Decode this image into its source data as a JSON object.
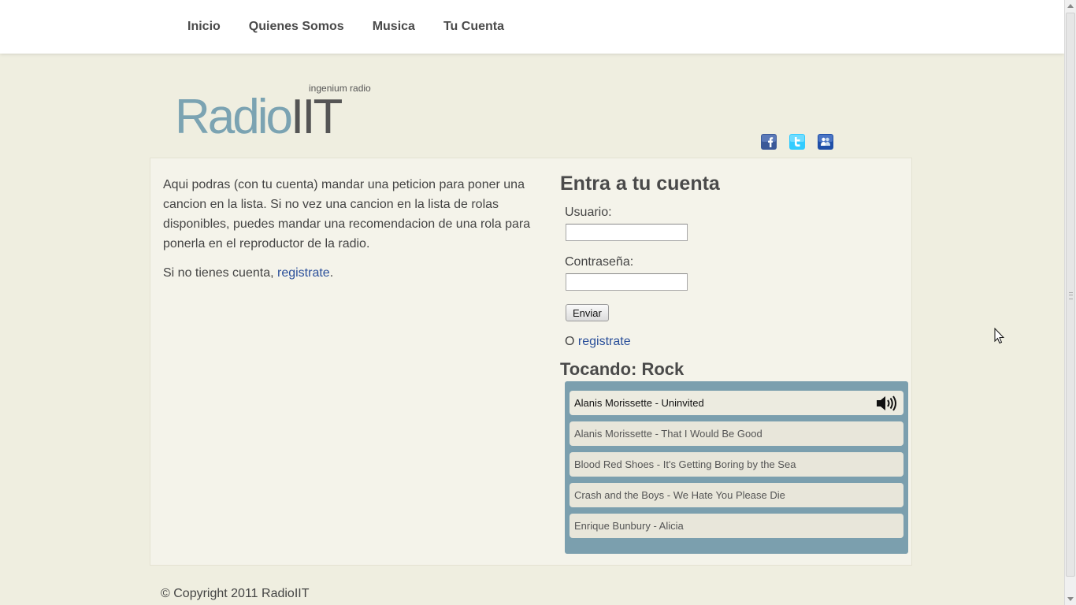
{
  "nav": {
    "items": [
      {
        "label": "Inicio"
      },
      {
        "label": "Quienes Somos"
      },
      {
        "label": "Musica"
      },
      {
        "label": "Tu Cuenta"
      }
    ]
  },
  "header": {
    "tagline": "ingenium radio",
    "logo_part1": "Radio",
    "logo_part2": "IIT"
  },
  "social": {
    "icons": [
      "facebook-icon",
      "twitter-icon",
      "messenger-icon"
    ],
    "colors": {
      "facebook": "#3b5998",
      "twitter": "#33ccff",
      "messenger": "#1f4fa8"
    }
  },
  "intro": {
    "paragraph": "Aqui podras (con tu cuenta) mandar una peticion para poner una cancion en la lista. Si no vez una cancion en la lista de rolas disponibles, puedes mandar una recomendacion de una rola para ponerla en el reproductor de la radio.",
    "no_account_prefix": "Si no tienes cuenta, ",
    "register_link": "registrate",
    "no_account_suffix": "."
  },
  "login": {
    "title": "Entra a tu cuenta",
    "user_label": "Usuario:",
    "user_value": "",
    "pass_label": "Contraseña:",
    "pass_value": "",
    "submit_label": "Enviar",
    "or_prefix": "O ",
    "register_link": "registrate"
  },
  "player": {
    "title": "Tocando: Rock",
    "tracks": [
      {
        "label": "Alanis Morissette - Uninvited",
        "playing": true
      },
      {
        "label": "Alanis Morissette - That I Would Be Good",
        "playing": false
      },
      {
        "label": "Blood Red Shoes - It's Getting Boring by the Sea",
        "playing": false
      },
      {
        "label": "Crash and the Boys - We Hate You Please Die",
        "playing": false
      },
      {
        "label": "Enrique Bunbury - Alicia",
        "playing": false
      }
    ],
    "colors": {
      "panel": "#7b9fae",
      "track_bg": "#e8e6da"
    }
  },
  "footer": {
    "copyright": "© Copyright 2011 RadioIIT"
  },
  "theme": {
    "page_bg": "#efeee0",
    "link": "#2a4f9a",
    "logo_accent": "#7ba3b2"
  }
}
